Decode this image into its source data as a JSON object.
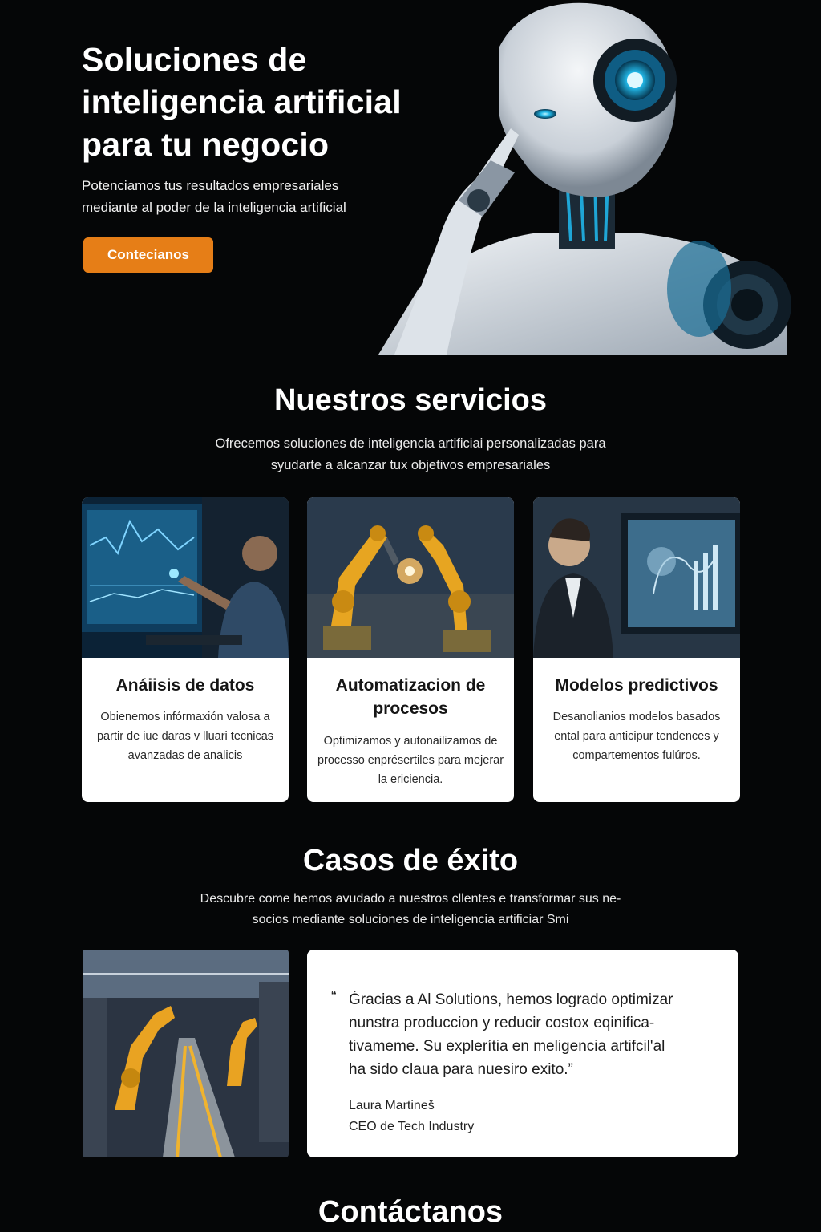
{
  "hero": {
    "title_lines": [
      "Soluciones de",
      "inteligencia artificial",
      "para tu negocio"
    ],
    "subtitle_lines": [
      "Potenciamos tus resultados empresariales",
      "mediante al poder de la inteligencia artificial"
    ],
    "cta_label": "Contecianos",
    "accent_color": "#e67e17"
  },
  "services": {
    "title": "Nuestros servicios",
    "subtitle_lines": [
      "Ofrecemos soluciones de inteligencia artificiai personalizadas para",
      "syudarte a alcanzar tux objetivos empresariales"
    ],
    "cards": [
      {
        "title": "Anáiisis de datos",
        "text": "Obienemos infórmaxión valosa a partir de iue daras v lluari tecnicas avanzadas de analicis",
        "image_icon": "data-analysis-screen-image"
      },
      {
        "title": "Automatizacion de procesos",
        "text": "Optimizamos y autonailizamos de processo enprésertiles para mejerar la ericiencia.",
        "image_icon": "industrial-robot-arms-image"
      },
      {
        "title": "Modelos predictivos",
        "text": "Desanolianios modelos basados ental para anticipur tendences y compartementos fulúros.",
        "image_icon": "predictive-dashboard-image"
      }
    ]
  },
  "cases": {
    "title": "Casos de éxito",
    "subtitle_lines": [
      "Descubre come hemos avudado a nuestros cllentes e transformar sus ne-",
      "socios mediante soluciones de inteligencia artificiar  Smi"
    ],
    "quote_mark": "“",
    "quote_lines": [
      "Ǵracias a Al Solutions, hemos logrado optimizar",
      "nunstra produccion y reducir costox eqinifica-",
      "tivameme. Su explerítia en meligencia artifcil'al",
      "ha sido claua para nuesiro exito.”"
    ],
    "author_name": "Laura Martineš",
    "author_role": "CEO de Tech Industry"
  },
  "contact": {
    "title": "Contáctanos"
  }
}
